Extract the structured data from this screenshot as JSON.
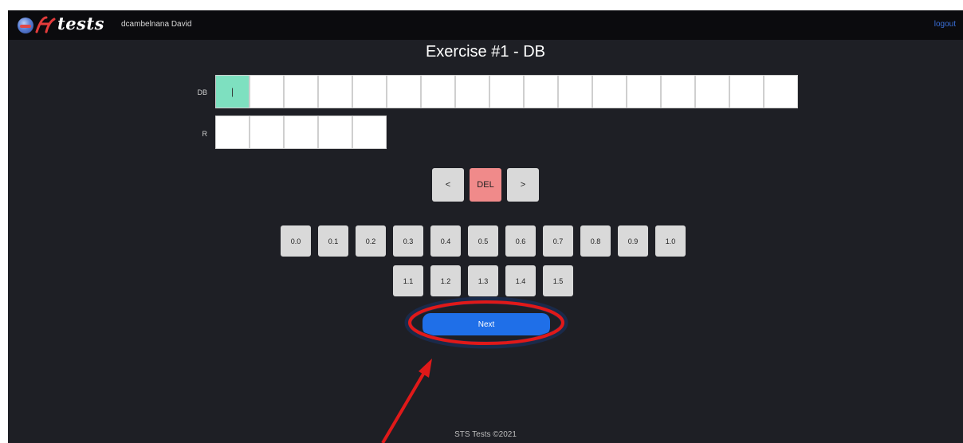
{
  "header": {
    "logo_text": "tests",
    "username": "dcambelnana David",
    "logout_label": "logout"
  },
  "exercise": {
    "title": "Exercise #1 - DB",
    "db_label": "DB",
    "r_label": "R",
    "db_cells": [
      "|",
      "",
      "",
      "",
      "",
      "",
      "",
      "",
      "",
      "",
      "",
      "",
      "",
      "",
      "",
      "",
      ""
    ],
    "r_cells": [
      "",
      "",
      "",
      "",
      ""
    ]
  },
  "controls": {
    "prev_label": "<",
    "del_label": "DEL",
    "next_cell_label": ">"
  },
  "value_buttons_row1": [
    "0.0",
    "0.1",
    "0.2",
    "0.3",
    "0.4",
    "0.5",
    "0.6",
    "0.7",
    "0.8",
    "0.9",
    "1.0"
  ],
  "value_buttons_row2": [
    "1.1",
    "1.2",
    "1.3",
    "1.4",
    "1.5"
  ],
  "next_label": "Next",
  "footer": "STS Tests ©2021",
  "colors": {
    "active_cell": "#7ee0c0",
    "del_button": "#f08a8a",
    "next_button": "#1f6fe8",
    "annotation": "#e01919"
  }
}
